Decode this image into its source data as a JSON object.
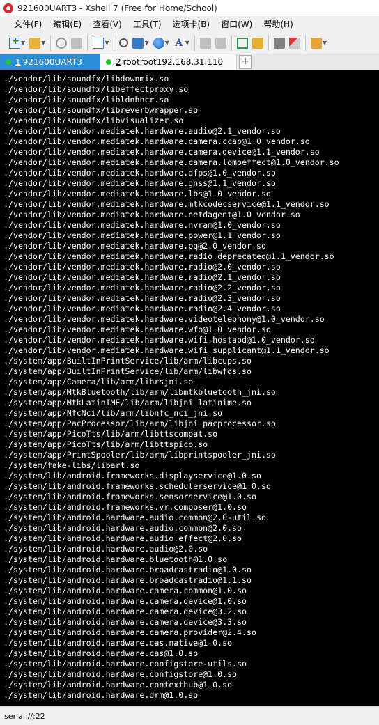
{
  "window": {
    "title": "921600UART3 - Xshell 7 (Free for Home/School)"
  },
  "menu": {
    "items": [
      "文件(F)",
      "编辑(E)",
      "查看(V)",
      "工具(T)",
      "选项卡(B)",
      "窗口(W)",
      "帮助(H)"
    ]
  },
  "toolbar": {
    "icons": [
      "new-session-icon",
      "open-folder-icon",
      "disconnect-icon",
      "reconnect-icon",
      "new-window-icon",
      "find-icon",
      "transfer-icon",
      "globe-icon",
      "font-icon",
      "script-icon",
      "record-icon",
      "fullscreen-icon",
      "lock-icon",
      "keyboard-icon",
      "highlight-icon",
      "add-icon"
    ],
    "font_glyph": "A"
  },
  "tabs": [
    {
      "num": "1",
      "label": "921600UART3",
      "active": true
    },
    {
      "num": "2",
      "label": "rootroot192.168.31.110",
      "active": false
    }
  ],
  "tab_add_label": "+",
  "terminal": {
    "lines": [
      "./vendor/lib/soundfx/libdownmix.so",
      "./vendor/lib/soundfx/libeffectproxy.so",
      "./vendor/lib/soundfx/libldnhncr.so",
      "./vendor/lib/soundfx/libreverbwrapper.so",
      "./vendor/lib/soundfx/libvisualizer.so",
      "./vendor/lib/vendor.mediatek.hardware.audio@2.1_vendor.so",
      "./vendor/lib/vendor.mediatek.hardware.camera.ccap@1.0_vendor.so",
      "./vendor/lib/vendor.mediatek.hardware.camera.device@1.1_vendor.so",
      "./vendor/lib/vendor.mediatek.hardware.camera.lomoeffect@1.0_vendor.so",
      "./vendor/lib/vendor.mediatek.hardware.dfps@1.0_vendor.so",
      "./vendor/lib/vendor.mediatek.hardware.gnss@1.1_vendor.so",
      "./vendor/lib/vendor.mediatek.hardware.lbs@1.0_vendor.so",
      "./vendor/lib/vendor.mediatek.hardware.mtkcodecservice@1.1_vendor.so",
      "./vendor/lib/vendor.mediatek.hardware.netdagent@1.0_vendor.so",
      "./vendor/lib/vendor.mediatek.hardware.nvram@1.0_vendor.so",
      "./vendor/lib/vendor.mediatek.hardware.power@1.1_vendor.so",
      "./vendor/lib/vendor.mediatek.hardware.pq@2.0_vendor.so",
      "./vendor/lib/vendor.mediatek.hardware.radio.deprecated@1.1_vendor.so",
      "./vendor/lib/vendor.mediatek.hardware.radio@2.0_vendor.so",
      "./vendor/lib/vendor.mediatek.hardware.radio@2.1_vendor.so",
      "./vendor/lib/vendor.mediatek.hardware.radio@2.2_vendor.so",
      "./vendor/lib/vendor.mediatek.hardware.radio@2.3_vendor.so",
      "./vendor/lib/vendor.mediatek.hardware.radio@2.4_vendor.so",
      "./vendor/lib/vendor.mediatek.hardware.videotelephony@1.0_vendor.so",
      "./vendor/lib/vendor.mediatek.hardware.wfo@1.0_vendor.so",
      "./vendor/lib/vendor.mediatek.hardware.wifi.hostapd@1.0_vendor.so",
      "./vendor/lib/vendor.mediatek.hardware.wifi.supplicant@1.1_vendor.so",
      "./system/app/BuiltInPrintService/lib/arm/libcups.so",
      "./system/app/BuiltInPrintService/lib/arm/libwfds.so",
      "./system/app/Camera/lib/arm/librsjni.so",
      "./system/app/MtkBluetooth/lib/arm/libmtkbluetooth_jni.so",
      "./system/app/MtkLatinIME/lib/arm/libjni_latinime.so",
      "./system/app/NfcNci/lib/arm/libnfc_nci_jni.so",
      "./system/app/PacProcessor/lib/arm/libjni_pacprocessor.so",
      "./system/app/PicoTts/lib/arm/libttscompat.so",
      "./system/app/PicoTts/lib/arm/libttspico.so",
      "./system/app/PrintSpooler/lib/arm/libprintspooler_jni.so",
      "./system/fake-libs/libart.so",
      "./system/lib/android.frameworks.displayservice@1.0.so",
      "./system/lib/android.frameworks.schedulerservice@1.0.so",
      "./system/lib/android.frameworks.sensorservice@1.0.so",
      "./system/lib/android.frameworks.vr.composer@1.0.so",
      "./system/lib/android.hardware.audio.common@2.0-util.so",
      "./system/lib/android.hardware.audio.common@2.0.so",
      "./system/lib/android.hardware.audio.effect@2.0.so",
      "./system/lib/android.hardware.audio@2.0.so",
      "./system/lib/android.hardware.bluetooth@1.0.so",
      "./system/lib/android.hardware.broadcastradio@1.0.so",
      "./system/lib/android.hardware.broadcastradio@1.1.so",
      "./system/lib/android.hardware.camera.common@1.0.so",
      "./system/lib/android.hardware.camera.device@1.0.so",
      "./system/lib/android.hardware.camera.device@3.2.so",
      "./system/lib/android.hardware.camera.device@3.3.so",
      "./system/lib/android.hardware.camera.provider@2.4.so",
      "./system/lib/android.hardware.cas.native@1.0.so",
      "./system/lib/android.hardware.cas@1.0.so",
      "./system/lib/android.hardware.configstore-utils.so",
      "./system/lib/android.hardware.configstore@1.0.so",
      "./system/lib/android.hardware.contexthub@1.0.so",
      "./system/lib/android.hardware.drm@1.0.so"
    ]
  },
  "status": {
    "text": "serial://:22"
  },
  "colors": {
    "terminal_bg": "#000000",
    "terminal_fg": "#ffffff",
    "active_tab": "#2a8fd8",
    "session_dot": "#22cc22",
    "logo": "#d8262c"
  }
}
